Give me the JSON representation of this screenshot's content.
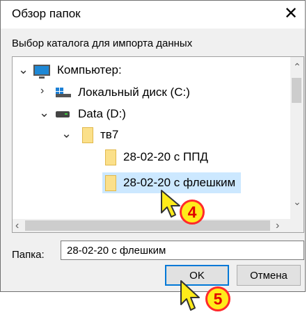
{
  "window": {
    "title": "Обзор папок",
    "close_glyph": "✕"
  },
  "description": "Выбор каталога для импорта данных",
  "tree": {
    "items": [
      {
        "label": "Компьютер:",
        "icon": "computer-icon",
        "expanded": true
      },
      {
        "label": "Локальный диск (C:)",
        "icon": "local-disk-icon",
        "expanded": false
      },
      {
        "label": "Data (D:)",
        "icon": "drive-icon",
        "expanded": true
      },
      {
        "label": "тв7",
        "icon": "folder-icon",
        "expanded": true
      },
      {
        "label": "28-02-20 с ППД",
        "icon": "folder-icon"
      },
      {
        "label": "28-02-20 с флешким",
        "icon": "folder-icon",
        "selected": true
      }
    ]
  },
  "folder_field": {
    "label": "Папка:",
    "value": "28-02-20 с флешким"
  },
  "buttons": {
    "ok": "OK",
    "cancel": "Отмена"
  },
  "markers": {
    "step4": "4",
    "step5": "5"
  },
  "colors": {
    "selection": "#cce8ff",
    "accent": "#0078d7",
    "marker_fill": "#ffeb1a",
    "marker_border": "#ff2a2a"
  }
}
